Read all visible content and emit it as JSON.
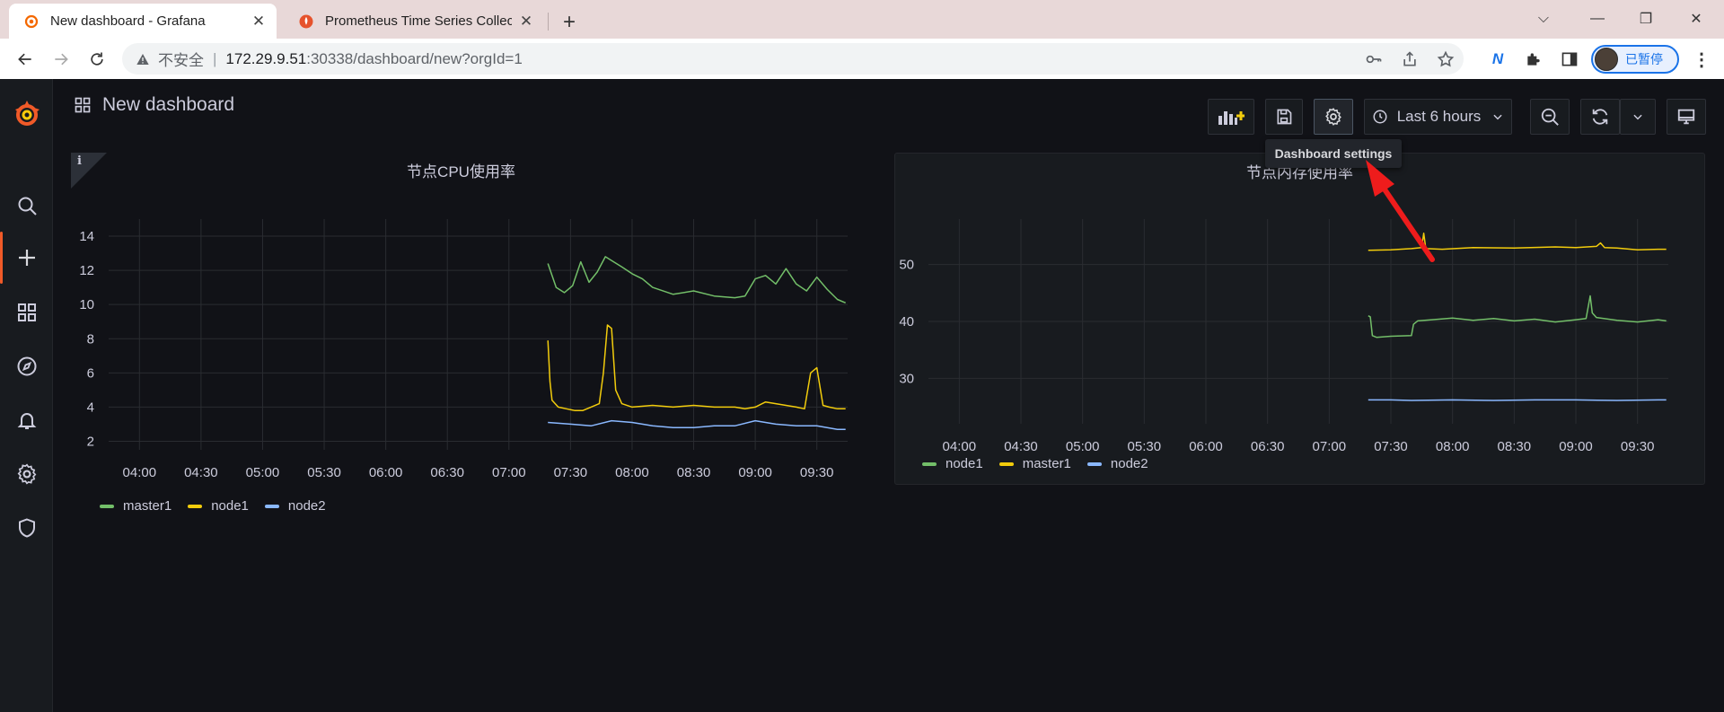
{
  "browser": {
    "tabs": [
      {
        "title": "New dashboard - Grafana",
        "close": "✕",
        "active": true
      },
      {
        "title": "Prometheus Time Series Collec",
        "close": "✕",
        "active": false
      }
    ],
    "new_tab": "+",
    "window_controls": {
      "minimize": "⌵",
      "restore": "—",
      "maximize": "❐",
      "close": "✕"
    },
    "address": {
      "security_label": "不安全",
      "separator": "|",
      "host": "172.29.9.51",
      "path": ":30338/dashboard/new?orgId=1"
    },
    "profile_label": "已暂停",
    "ext_label": "N"
  },
  "sidemenu": {
    "items": [
      "search-icon",
      "plus-icon",
      "dashboards-icon",
      "explore-icon",
      "alerting-icon",
      "configuration-icon",
      "server-admin-icon"
    ]
  },
  "dashboard": {
    "title": "New dashboard",
    "time_picker": "Last 6 hours",
    "tooltip": "Dashboard settings",
    "accent": "#f05a28"
  },
  "panels": {
    "cpu": {
      "title": "节点CPU使用率",
      "info": "i"
    },
    "mem": {
      "title": "节点内存使用率"
    }
  },
  "chart_data": [
    {
      "type": "line",
      "title": "节点CPU使用率",
      "x_ticks": [
        "04:00",
        "04:30",
        "05:00",
        "05:30",
        "06:00",
        "06:30",
        "07:00",
        "07:30",
        "08:00",
        "08:30",
        "09:00",
        "09:30"
      ],
      "y_ticks": [
        2,
        4,
        6,
        8,
        10,
        12,
        14
      ],
      "ylim": [
        1.5,
        15
      ],
      "x_range": [
        "03:45",
        "09:45"
      ],
      "grid": true,
      "legend": "bottom-left",
      "series": [
        {
          "name": "master1",
          "color": "#73bf69",
          "x": [
            "07:19",
            "07:23",
            "07:27",
            "07:31",
            "07:35",
            "07:39",
            "07:43",
            "07:47",
            "07:51",
            "07:55",
            "08:00",
            "08:05",
            "08:10",
            "08:20",
            "08:30",
            "08:40",
            "08:50",
            "08:55",
            "09:00",
            "09:05",
            "09:10",
            "09:15",
            "09:20",
            "09:25",
            "09:30",
            "09:35",
            "09:40",
            "09:44"
          ],
          "values": [
            12.4,
            11.0,
            10.7,
            11.1,
            12.5,
            11.3,
            11.9,
            12.8,
            12.5,
            12.2,
            11.8,
            11.5,
            11.0,
            10.6,
            10.8,
            10.5,
            10.4,
            10.5,
            11.5,
            11.7,
            11.2,
            12.1,
            11.2,
            10.8,
            11.6,
            10.9,
            10.3,
            10.1
          ]
        },
        {
          "name": "node1",
          "color": "#f2cc0c",
          "x": [
            "07:19",
            "07:20",
            "07:21",
            "07:24",
            "07:28",
            "07:32",
            "07:36",
            "07:40",
            "07:44",
            "07:46",
            "07:48",
            "07:50",
            "07:52",
            "07:55",
            "08:00",
            "08:10",
            "08:20",
            "08:30",
            "08:40",
            "08:50",
            "08:55",
            "09:00",
            "09:05",
            "09:10",
            "09:15",
            "09:20",
            "09:24",
            "09:27",
            "09:30",
            "09:33",
            "09:36",
            "09:40",
            "09:44"
          ],
          "values": [
            7.9,
            5.5,
            4.4,
            4.0,
            3.9,
            3.8,
            3.8,
            4.0,
            4.2,
            6.0,
            8.8,
            8.6,
            5.0,
            4.2,
            4.0,
            4.1,
            4.0,
            4.1,
            4.0,
            4.0,
            3.9,
            4.0,
            4.3,
            4.2,
            4.1,
            4.0,
            3.9,
            6.0,
            6.3,
            4.1,
            4.0,
            3.9,
            3.9
          ]
        },
        {
          "name": "node2",
          "color": "#8ab8ff",
          "x": [
            "07:19",
            "07:30",
            "07:40",
            "07:50",
            "08:00",
            "08:10",
            "08:20",
            "08:30",
            "08:40",
            "08:50",
            "09:00",
            "09:10",
            "09:20",
            "09:30",
            "09:40",
            "09:44"
          ],
          "values": [
            3.1,
            3.0,
            2.9,
            3.2,
            3.1,
            2.9,
            2.8,
            2.8,
            2.9,
            2.9,
            3.2,
            3.0,
            2.9,
            2.9,
            2.7,
            2.7
          ]
        }
      ]
    },
    {
      "type": "line",
      "title": "节点内存使用率",
      "x_ticks": [
        "04:00",
        "04:30",
        "05:00",
        "05:30",
        "06:00",
        "06:30",
        "07:00",
        "07:30",
        "08:00",
        "08:30",
        "09:00",
        "09:30"
      ],
      "y_ticks": [
        30,
        40,
        50
      ],
      "ylim": [
        22,
        58
      ],
      "x_range": [
        "03:45",
        "09:45"
      ],
      "grid": true,
      "legend": "bottom-left",
      "series": [
        {
          "name": "node1",
          "color": "#73bf69",
          "x": [
            "07:19",
            "07:20",
            "07:21",
            "07:23",
            "07:30",
            "07:40",
            "07:41",
            "07:43",
            "07:50",
            "08:00",
            "08:10",
            "08:20",
            "08:30",
            "08:40",
            "08:50",
            "09:00",
            "09:05",
            "09:07",
            "09:08",
            "09:10",
            "09:20",
            "09:30",
            "09:40",
            "09:44"
          ],
          "values": [
            41.0,
            40.8,
            37.5,
            37.2,
            37.4,
            37.5,
            39.5,
            40.1,
            40.3,
            40.6,
            40.2,
            40.5,
            40.1,
            40.4,
            39.9,
            40.3,
            40.5,
            44.5,
            41.5,
            40.7,
            40.2,
            39.9,
            40.3,
            40.1
          ]
        },
        {
          "name": "master1",
          "color": "#f2cc0c",
          "x": [
            "07:19",
            "07:30",
            "07:40",
            "07:45",
            "07:46",
            "07:47",
            "07:55",
            "08:10",
            "08:30",
            "08:50",
            "09:00",
            "09:10",
            "09:12",
            "09:14",
            "09:20",
            "09:30",
            "09:40",
            "09:44"
          ],
          "values": [
            52.5,
            52.6,
            52.8,
            53.0,
            55.5,
            52.8,
            52.7,
            53.0,
            52.9,
            53.1,
            53.0,
            53.2,
            53.8,
            53.0,
            52.9,
            52.6,
            52.7,
            52.7
          ]
        },
        {
          "name": "node2",
          "color": "#8ab8ff",
          "x": [
            "07:19",
            "07:30",
            "07:40",
            "08:00",
            "08:20",
            "08:40",
            "09:00",
            "09:20",
            "09:40",
            "09:44"
          ],
          "values": [
            26.2,
            26.2,
            26.1,
            26.2,
            26.1,
            26.2,
            26.2,
            26.1,
            26.2,
            26.2
          ]
        }
      ]
    }
  ]
}
